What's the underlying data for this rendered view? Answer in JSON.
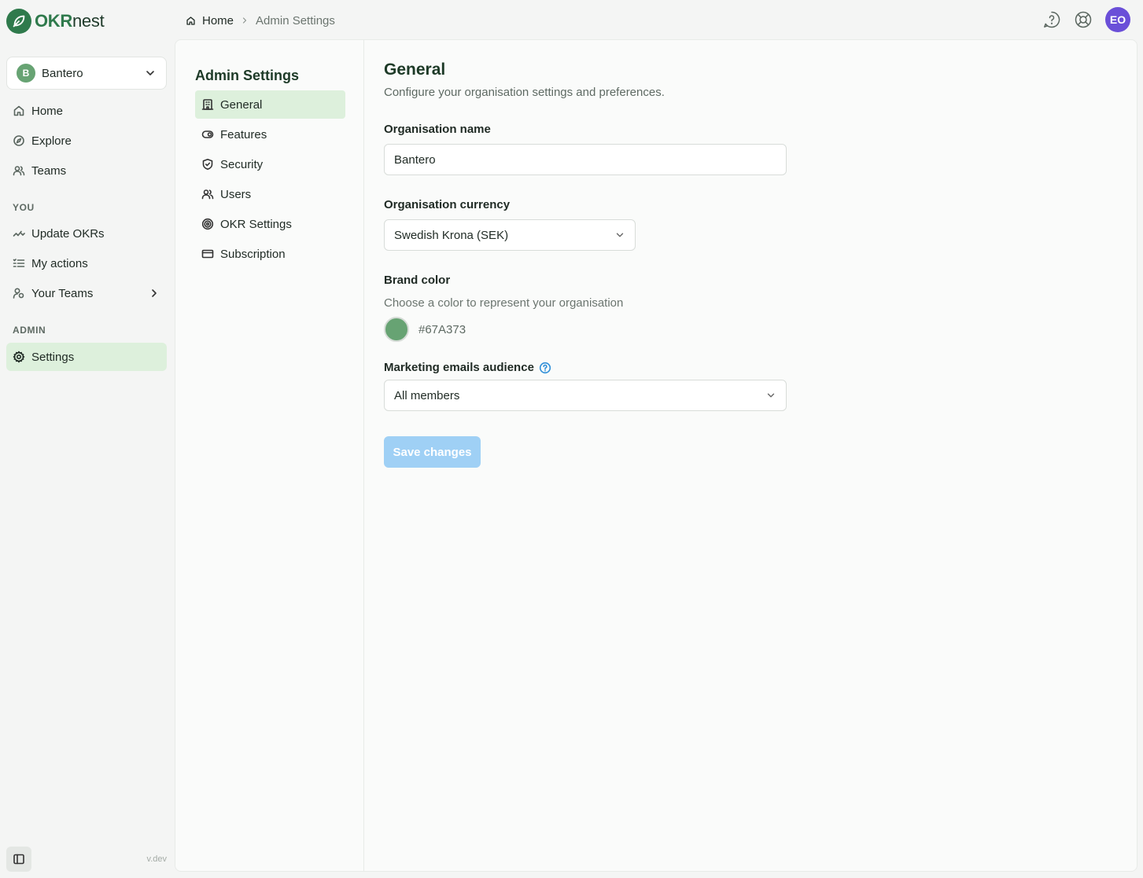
{
  "app": {
    "logo_brand": "OKR",
    "logo_suffix": "nest",
    "version": "v.dev"
  },
  "org": {
    "initial": "B",
    "name": "Bantero"
  },
  "sidebar": {
    "main": [
      {
        "label": "Home",
        "icon": "home-icon"
      },
      {
        "label": "Explore",
        "icon": "compass-icon"
      },
      {
        "label": "Teams",
        "icon": "users-icon"
      }
    ],
    "you_label": "YOU",
    "you": [
      {
        "label": "Update OKRs",
        "icon": "activity-icon"
      },
      {
        "label": "My actions",
        "icon": "checklist-icon"
      },
      {
        "label": "Your Teams",
        "icon": "user-group-icon"
      }
    ],
    "admin_label": "ADMIN",
    "admin": [
      {
        "label": "Settings",
        "icon": "gear-icon",
        "active": true
      }
    ]
  },
  "breadcrumb": {
    "home": "Home",
    "current": "Admin Settings"
  },
  "header": {
    "user_initials": "EO",
    "avatar_color": "#6a4fd8"
  },
  "settings_nav": {
    "title": "Admin Settings",
    "items": [
      {
        "label": "General",
        "icon": "building-icon",
        "active": true
      },
      {
        "label": "Features",
        "icon": "toggle-icon"
      },
      {
        "label": "Security",
        "icon": "shield-icon"
      },
      {
        "label": "Users",
        "icon": "users-icon"
      },
      {
        "label": "OKR Settings",
        "icon": "target-icon"
      },
      {
        "label": "Subscription",
        "icon": "credit-card-icon"
      }
    ]
  },
  "general": {
    "title": "General",
    "subtitle": "Configure your organisation settings and preferences.",
    "org_name_label": "Organisation name",
    "org_name_value": "Bantero",
    "currency_label": "Organisation currency",
    "currency_value": "Swedish Krona (SEK)",
    "brand_label": "Brand color",
    "brand_helper": "Choose a color to represent your organisation",
    "brand_hex": "#67A373",
    "marketing_label": "Marketing emails audience",
    "marketing_value": "All members",
    "save_label": "Save changes"
  },
  "colors": {
    "brand": "#67A373",
    "accent_green": "#2f7a4c",
    "active_bg": "#ddf0dc",
    "save_disabled": "#9fd0f5"
  }
}
